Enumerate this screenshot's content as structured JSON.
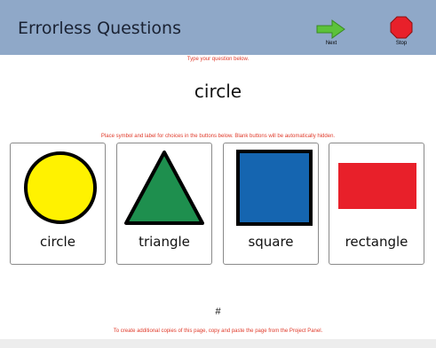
{
  "header": {
    "title": "Errorless Questions",
    "next_label": "Next",
    "stop_label": "Stop"
  },
  "instructions": {
    "question_hint": "Type your question below.",
    "choices_hint": "Place symbol and label for choices in the buttons below.  Blank buttons will be automatically hidden.",
    "footer_hint": "To create additional copies of this page, copy and paste the page from the Project Panel."
  },
  "question": {
    "text": "circle"
  },
  "choices": [
    {
      "label": "circle",
      "symbol": "circle-icon",
      "color": "#fff200"
    },
    {
      "label": "triangle",
      "symbol": "triangle-icon",
      "color": "#1e8f4e"
    },
    {
      "label": "square",
      "symbol": "square-icon",
      "color": "#1565b0"
    },
    {
      "label": "rectangle",
      "symbol": "rectangle-icon",
      "color": "#e8202a"
    }
  ],
  "page_number": "#",
  "colors": {
    "header_bg": "#8fa8c8",
    "hint_text": "#e03a2a",
    "next_arrow": "#5cc23a",
    "stop_sign": "#e8202a"
  }
}
